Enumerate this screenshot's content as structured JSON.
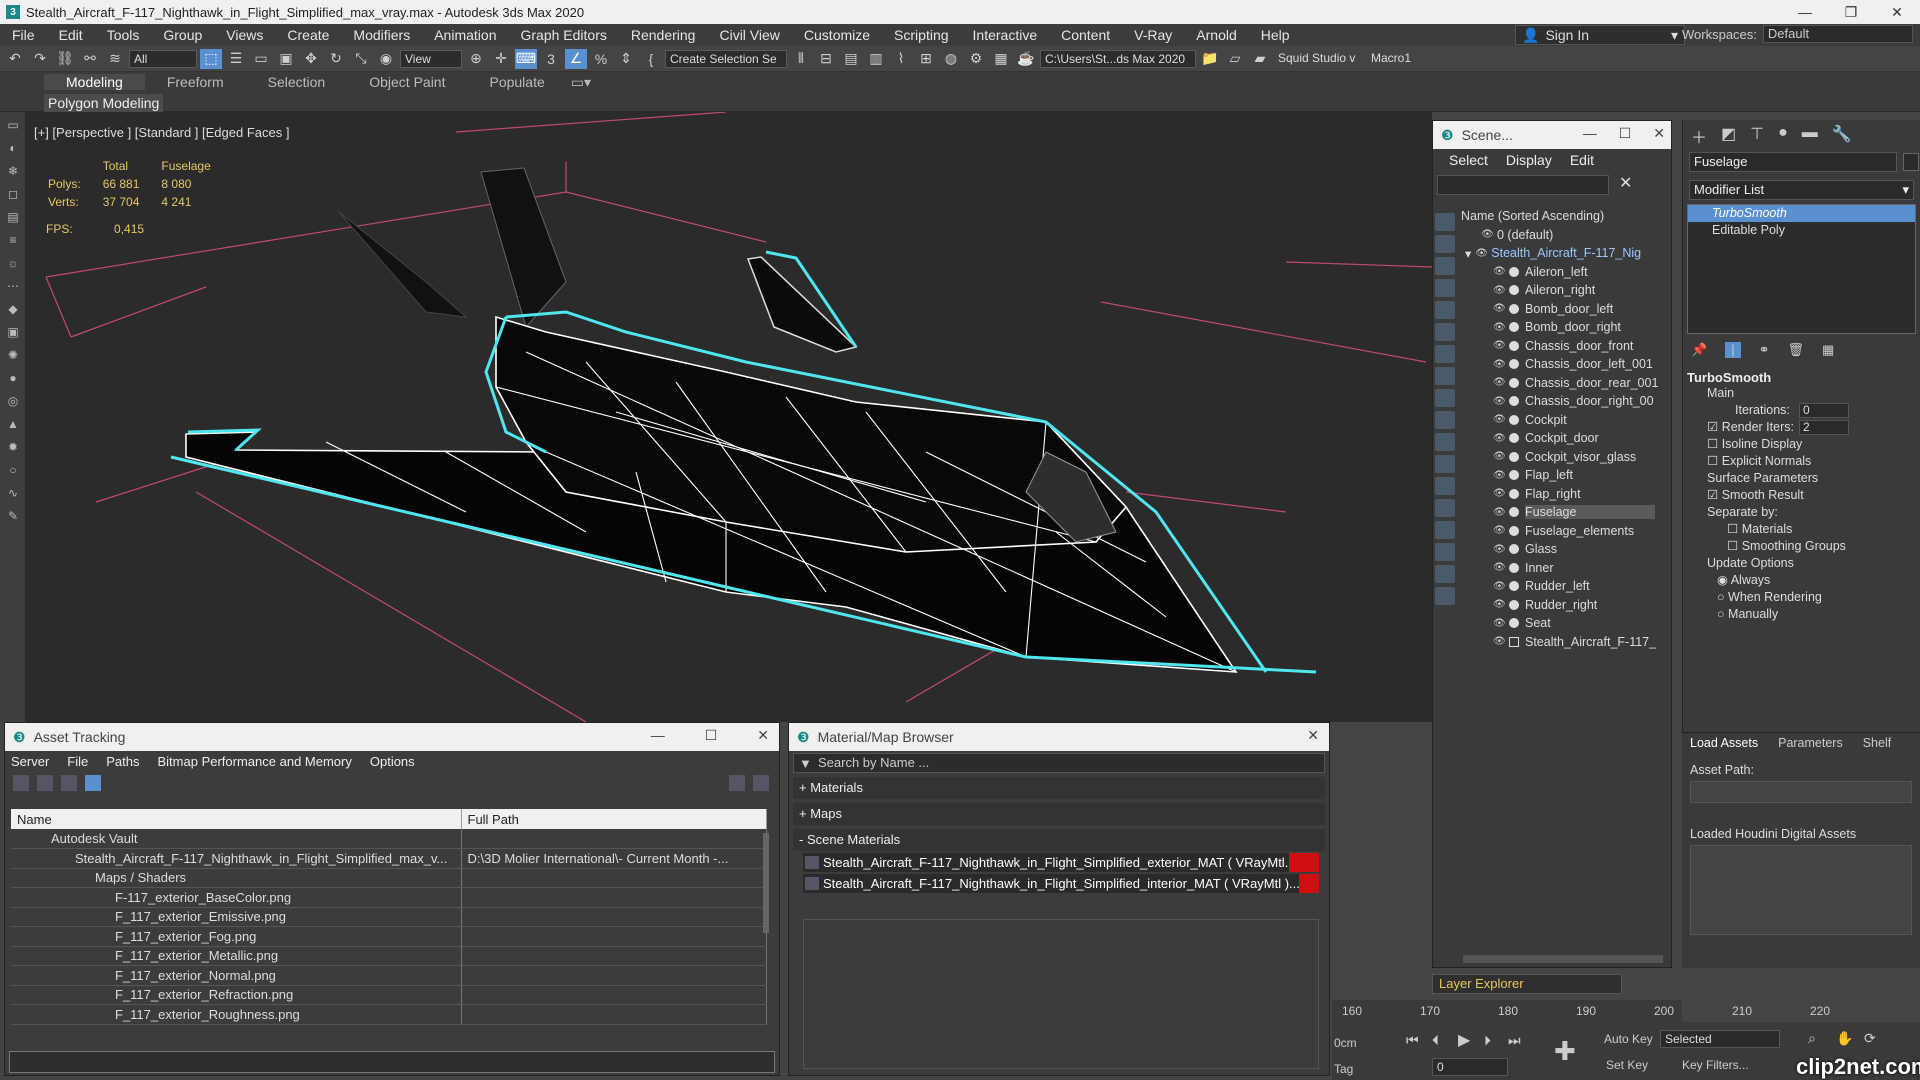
{
  "titlebar": {
    "title": "Stealth_Aircraft_F-117_Nighthawk_in_Flight_Simplified_max_vray.max - Autodesk 3ds Max 2020",
    "app_icon": "3"
  },
  "menu": [
    "File",
    "Edit",
    "Tools",
    "Group",
    "Views",
    "Create",
    "Modifiers",
    "Animation",
    "Graph Editors",
    "Rendering",
    "Civil View",
    "Customize",
    "Scripting",
    "Interactive",
    "Content",
    "V-Ray",
    "Arnold",
    "Help"
  ],
  "signin": "Sign In",
  "workspaces": {
    "label": "Workspaces:",
    "value": "Default"
  },
  "toolbar": {
    "filter": "All",
    "view": "View",
    "selection_set": "Create Selection Se",
    "path": "C:\\Users\\St...ds Max 2020",
    "studio": "Squid Studio v",
    "macro": "Macro1"
  },
  "ribbon": {
    "tabs": [
      "Modeling",
      "Freeform",
      "Selection",
      "Object Paint",
      "Populate"
    ],
    "sub": "Polygon Modeling"
  },
  "viewport": {
    "label": "[+] [Perspective ] [Standard ] [Edged Faces ]",
    "stats": {
      "col_total": "Total",
      "col_sel": "Fuselage",
      "polys_label": "Polys:",
      "polys_total": "66 881",
      "polys_sel": "8 080",
      "verts_label": "Verts:",
      "verts_total": "37 704",
      "verts_sel": "4 241",
      "fps_label": "FPS:",
      "fps": "0,415"
    }
  },
  "scene": {
    "title": "Scene...",
    "menu": [
      "Select",
      "Display",
      "Edit"
    ],
    "column": "Name (Sorted Ascending)",
    "root": "0 (default)",
    "group": "Stealth_Aircraft_F-117_Nig",
    "items": [
      "Aileron_left",
      "Aileron_right",
      "Bomb_door_left",
      "Bomb_door_right",
      "Chassis_door_front",
      "Chassis_door_left_001",
      "Chassis_door_rear_001",
      "Chassis_door_right_00",
      "Cockpit",
      "Cockpit_door",
      "Cockpit_visor_glass",
      "Flap_left",
      "Flap_right",
      "Fuselage",
      "Fuselage_elements",
      "Glass",
      "Inner",
      "Rudder_left",
      "Rudder_right",
      "Seat",
      "Stealth_Aircraft_F-117_"
    ],
    "selected": "Fuselage",
    "layer_explorer": "Layer Explorer"
  },
  "command": {
    "object_name": "Fuselage",
    "modifier_list": "Modifier List",
    "stack": [
      "TurboSmooth",
      "Editable Poly"
    ],
    "turbosmooth": {
      "title": "TurboSmooth",
      "main": "Main",
      "iterations_label": "Iterations:",
      "iterations": "0",
      "render_iters_label": "Render Iters:",
      "render_iters": "2",
      "isoline": "Isoline Display",
      "explicit": "Explicit Normals",
      "surface": "Surface Parameters",
      "smooth_result": "Smooth Result",
      "separate": "Separate by:",
      "materials": "Materials",
      "smoothing": "Smoothing Groups",
      "update": "Update Options",
      "always": "Always",
      "when_rendering": "When Rendering",
      "manually": "Manually"
    }
  },
  "lower": {
    "tabs": [
      "Load Assets",
      "Parameters",
      "Shelf"
    ],
    "asset_path": "Asset Path:",
    "loaded": "Loaded Houdini Digital Assets"
  },
  "asset": {
    "title": "Asset Tracking",
    "menu": [
      "Server",
      "File",
      "Paths",
      "Bitmap Performance and Memory",
      "Options"
    ],
    "headers": [
      "Name",
      "Full Path"
    ],
    "rows": [
      {
        "name": "Autodesk Vault",
        "path": "",
        "indent": 1
      },
      {
        "name": "Stealth_Aircraft_F-117_Nighthawk_in_Flight_Simplified_max_v...",
        "path": "D:\\3D Molier International\\- Current Month -...",
        "indent": 2
      },
      {
        "name": "Maps / Shaders",
        "path": "",
        "indent": 3
      },
      {
        "name": "F-117_exterior_BaseColor.png",
        "path": "",
        "indent": 4
      },
      {
        "name": "F_117_exterior_Emissive.png",
        "path": "",
        "indent": 4
      },
      {
        "name": "F_117_exterior_Fog.png",
        "path": "",
        "indent": 4
      },
      {
        "name": "F_117_exterior_Metallic.png",
        "path": "",
        "indent": 4
      },
      {
        "name": "F_117_exterior_Normal.png",
        "path": "",
        "indent": 4
      },
      {
        "name": "F_117_exterior_Refraction.png",
        "path": "",
        "indent": 4
      },
      {
        "name": "F_117_exterior_Roughness.png",
        "path": "",
        "indent": 4
      }
    ]
  },
  "matbrowser": {
    "title": "Material/Map Browser",
    "search": "Search by Name ...",
    "sections": [
      "+ Materials",
      "+ Maps",
      "- Scene Materials"
    ],
    "materials": [
      "Stealth_Aircraft_F-117_Nighthawk_in_Flight_Simplified_exterior_MAT ( VRayMtl...",
      "Stealth_Aircraft_F-117_Nighthawk_in_Flight_Simplified_interior_MAT ( VRayMtl )..."
    ]
  },
  "timeline": {
    "ticks": [
      "160",
      "170",
      "180",
      "190",
      "200",
      "210",
      "220"
    ],
    "unit": "0cm",
    "tag": "Tag"
  },
  "anim": {
    "autokey": "Auto Key",
    "selected": "Selected",
    "setkey": "Set Key",
    "keyfilters": "Key Filters...",
    "frame": "0"
  },
  "watermark": "clip2net.com"
}
